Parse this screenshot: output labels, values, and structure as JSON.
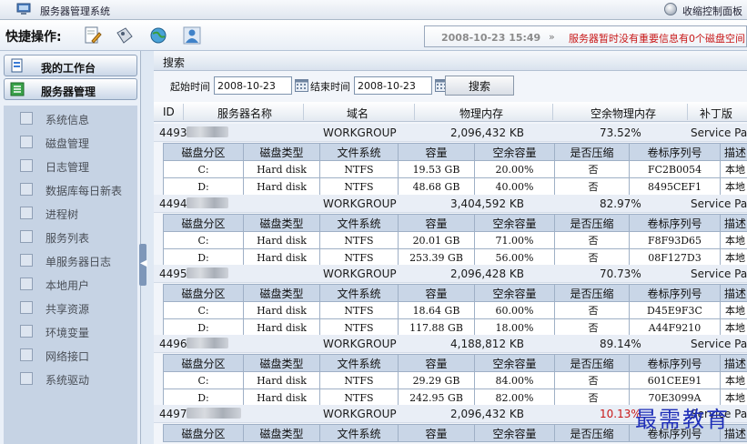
{
  "titlebar": {
    "title": "服务器管理系统",
    "control_panel": "收缩控制面板"
  },
  "quickbar": {
    "label": "快捷操作:"
  },
  "status": {
    "time": "2008-10-23 15:49",
    "arrow": "»",
    "message": "服务器暂时没有重要信息有0个磁盘空间"
  },
  "sidebar": {
    "workbench": "我的工作台",
    "server_mgmt": "服务器管理",
    "items": [
      "系统信息",
      "磁盘管理",
      "日志管理",
      "数据库每日新表",
      "进程树",
      "服务列表",
      "单服务器日志",
      "本地用户",
      "共享资源",
      "环境变量",
      "网络接口",
      "系统驱动"
    ]
  },
  "search": {
    "title": "搜索",
    "start_label": "起始时间",
    "start_value": "2008-10-23",
    "end_label": "结束时间",
    "end_value": "2008-10-23",
    "button": "搜索"
  },
  "table": {
    "headers": [
      "ID",
      "服务器名称",
      "域名",
      "物理内存",
      "空余物理内存",
      "补丁版"
    ],
    "disk_headers": [
      "磁盘分区",
      "磁盘类型",
      "文件系统",
      "容量",
      "空余容量",
      "是否压缩",
      "卷标序列号",
      "描述"
    ],
    "servers": [
      {
        "id": "4493",
        "domain": "WORKGROUP",
        "memory": "2,096,432 KB",
        "free_pct": "73.52%",
        "patch": "Service Pack",
        "disks": [
          {
            "part": "C:",
            "type": "Hard disk",
            "fs": "NTFS",
            "cap": "19.53 GB",
            "free": "20.00%",
            "comp": "否",
            "serial": "FC2B0054",
            "desc": "本地"
          },
          {
            "part": "D:",
            "type": "Hard disk",
            "fs": "NTFS",
            "cap": "48.68 GB",
            "free": "40.00%",
            "comp": "否",
            "serial": "8495CEF1",
            "desc": "本地"
          }
        ]
      },
      {
        "id": "4494",
        "domain": "WORKGROUP",
        "memory": "3,404,592 KB",
        "free_pct": "82.97%",
        "patch": "Service Pack",
        "disks": [
          {
            "part": "C:",
            "type": "Hard disk",
            "fs": "NTFS",
            "cap": "20.01 GB",
            "free": "71.00%",
            "comp": "否",
            "serial": "F8F93D65",
            "desc": "本地"
          },
          {
            "part": "D:",
            "type": "Hard disk",
            "fs": "NTFS",
            "cap": "253.39 GB",
            "free": "56.00%",
            "comp": "否",
            "serial": "08F127D3",
            "desc": "本地"
          }
        ]
      },
      {
        "id": "4495",
        "domain": "WORKGROUP",
        "memory": "2,096,428 KB",
        "free_pct": "70.73%",
        "patch": "Service Pack",
        "disks": [
          {
            "part": "C:",
            "type": "Hard disk",
            "fs": "NTFS",
            "cap": "18.64 GB",
            "free": "60.00%",
            "comp": "否",
            "serial": "D45E9F3C",
            "desc": "本地"
          },
          {
            "part": "D:",
            "type": "Hard disk",
            "fs": "NTFS",
            "cap": "117.88 GB",
            "free": "18.00%",
            "comp": "否",
            "serial": "A44F9210",
            "desc": "本地"
          }
        ]
      },
      {
        "id": "4496",
        "domain": "WORKGROUP",
        "memory": "4,188,812 KB",
        "free_pct": "89.14%",
        "patch": "Service Pack",
        "disks": [
          {
            "part": "C:",
            "type": "Hard disk",
            "fs": "NTFS",
            "cap": "29.29 GB",
            "free": "84.00%",
            "comp": "否",
            "serial": "601CEE91",
            "desc": "本地"
          },
          {
            "part": "D:",
            "type": "Hard disk",
            "fs": "NTFS",
            "cap": "242.95 GB",
            "free": "82.00%",
            "comp": "否",
            "serial": "70E3099A",
            "desc": "本地"
          }
        ]
      },
      {
        "id": "4497",
        "domain": "WORKGROUP",
        "memory": "2,096,432 KB",
        "free_pct": "10.13%",
        "patch": "Service Pack",
        "warn": "#c81818",
        "disks": []
      }
    ]
  },
  "watermark": "最需教育",
  "colors": {
    "warn": "#c81818",
    "accent": "#3a5f8f"
  }
}
